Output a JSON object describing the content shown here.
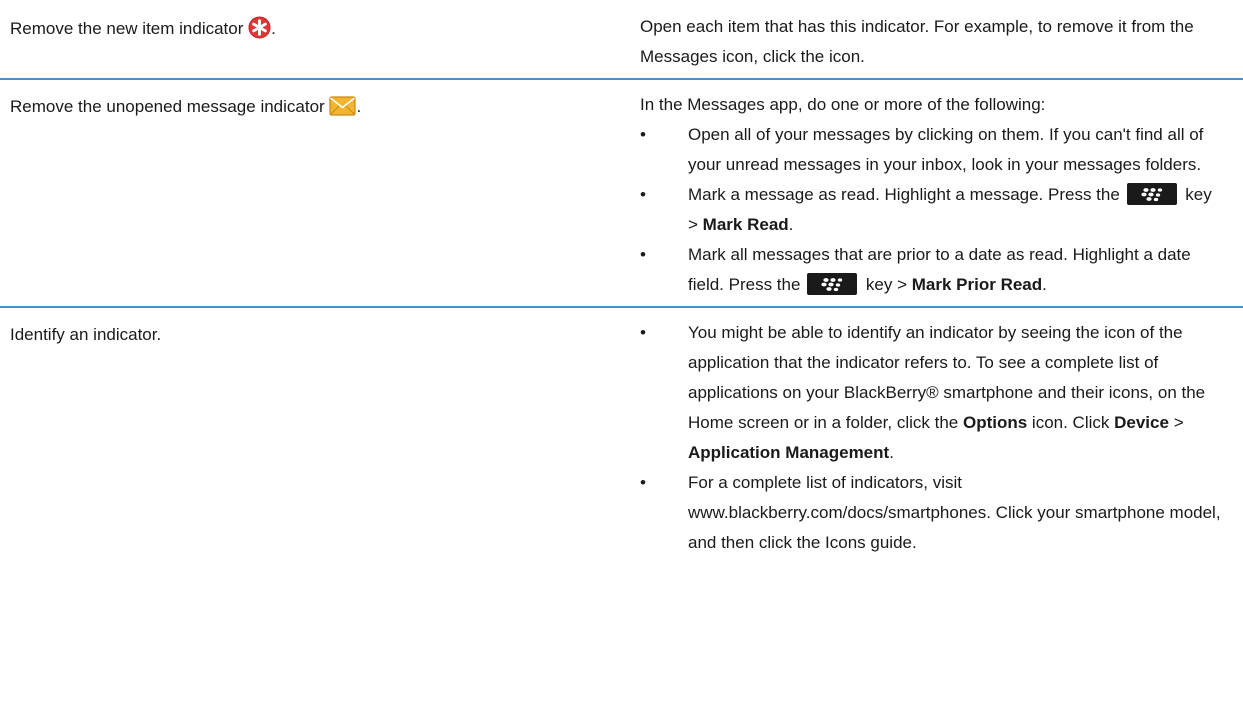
{
  "rows": [
    {
      "task": "Remove the new item indicator",
      "task_suffix": ".",
      "task_icon": "new-item-indicator-icon",
      "description": "Open each item that has this indicator. For example, to remove it from the Messages icon, click the icon."
    },
    {
      "task": "Remove the unopened message indicator",
      "task_suffix": ".",
      "task_icon": "unopened-message-icon",
      "intro": "In the Messages app, do one or more of the following:",
      "bullet_char": "•",
      "bullets": [
        {
          "text": "Open all of your messages by clicking on them. If you can't find all of your unread messages in your inbox, look in your messages folders."
        },
        {
          "text_before": "Mark a message as read. Highlight a message. Press the",
          "key_icon": "blackberry-menu-key-icon",
          "text_mid": "key >",
          "bold": "Mark Read",
          "text_after": "."
        },
        {
          "text_before": "Mark all messages that are prior to a date as read. Highlight a date field. Press the",
          "key_icon": "blackberry-menu-key-icon",
          "text_mid": "key >",
          "bold": "Mark Prior Read",
          "text_after": "."
        }
      ]
    },
    {
      "task": "Identify an indicator.",
      "bullet_char": "•",
      "bullets": [
        {
          "text_before": "You might be able to identify an indicator by seeing the icon of the application that the indicator refers to. To see a complete list of applications on your BlackBerry® smartphone and their icons, on the Home screen or in a folder, click the",
          "bold1": "Options",
          "text_mid1": "icon. Click",
          "bold2": "Device",
          "text_mid2": ">",
          "bold3": "Application Management",
          "text_after": "."
        },
        {
          "text": "For a complete list of indicators, visit www.blackberry.com/docs/smartphones. Click your smartphone model, and then click the Icons guide."
        }
      ]
    }
  ],
  "colors": {
    "row_divider": "#4a8fc9",
    "new_item_icon": "#e0363a",
    "envelope_icon": "#f2b530",
    "key_background": "#1a1a1a"
  }
}
